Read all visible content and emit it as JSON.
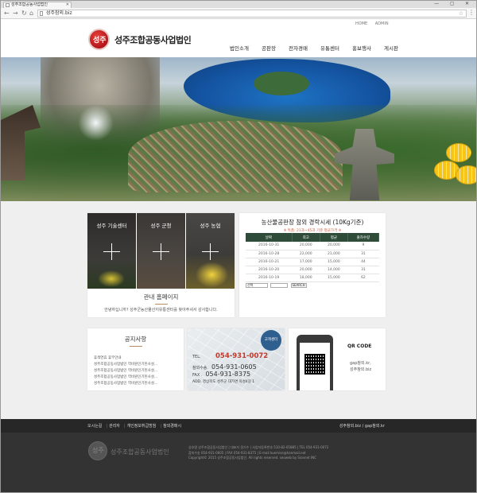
{
  "browser": {
    "tab_title": "성주조합공동사업법인",
    "url": "성주참외.biz",
    "window_controls": "—  ◻  ✕"
  },
  "header": {
    "logo_text": "성주조합공동사업법인",
    "logo_mark": "성주",
    "top_links": [
      "HOME",
      "ADMIN"
    ],
    "menu": [
      "법인소개",
      "공판장",
      "전자경매",
      "유통센터",
      "홍보행사",
      "게시판"
    ]
  },
  "business": {
    "panels": [
      "성주 기술센터",
      "성주 군청",
      "성주 농협"
    ],
    "title": "관내 홈페이지",
    "desc": "안녕하십니까? 성주군농산물산지유통센터를 찾아주셔서 감사합니다."
  },
  "market": {
    "title": "농산물공판장 참외 경락시세 (10Kg기준)",
    "note": "※ 특품: 21과~45과 기준 평균가격 ※",
    "columns": [
      "날짜",
      "최고",
      "평균",
      "출하수량"
    ],
    "rows": [
      [
        "2016-10-31",
        "20,000",
        "20,000",
        "9"
      ],
      [
        "2016-10-28",
        "22,000",
        "21,000",
        "31"
      ],
      [
        "2016-10-21",
        "17,000",
        "15,000",
        "44"
      ],
      [
        "2016-10-20",
        "20,000",
        "14,000",
        "31"
      ],
      [
        "2016-10-19",
        "18,000",
        "15,000",
        "62"
      ]
    ],
    "select_value": "선택",
    "search_label": "SEARCH"
  },
  "notice": {
    "title": "공지사항",
    "items": [
      "휴색연휴 휴무안내",
      "성주조합공동사업법인 역비원인기된사설...",
      "성주조합공동사업법인 역비원인기된사설...",
      "성주조합공동사업법인 역비원인기된사설...",
      "성주조합공동사업법인 역비원인기된사설..."
    ]
  },
  "contact": {
    "badge": "고객센터",
    "tel_label": "TEL.",
    "tel": "054-931-0072",
    "rows": [
      {
        "label": "참외수송.",
        "value": "054-931-0605"
      },
      {
        "label": "FAX .",
        "value": "054-931-8375"
      }
    ],
    "address": "ADD. 경상북도 성주군 대가면 옥성4길 1"
  },
  "qr": {
    "title": "QR CODE",
    "urls": [
      "gap참외.kr,",
      "성주참외.biz"
    ]
  },
  "footer": {
    "links": [
      "오시는길",
      "관리자",
      "개인정보취급방침",
      "참외경매시"
    ],
    "domains": "성주참외.biz / gap참외.kr",
    "logo_mark": "성주",
    "name": "성주조합공동사업법인",
    "info": [
      "상호명 성주조합공동사업법인 | 대표자 정기수 | 사업자등록번호 510-82-05885 | TEL 054-931-0072",
      "참외수송 054-931-0605 | FAX 054-931-8375 | E-mail kuemise@hanmail.net",
      "Copyright© 2015 성주조합공동사업법인. All rights reserved. seoweb by Sionnet INC"
    ]
  }
}
